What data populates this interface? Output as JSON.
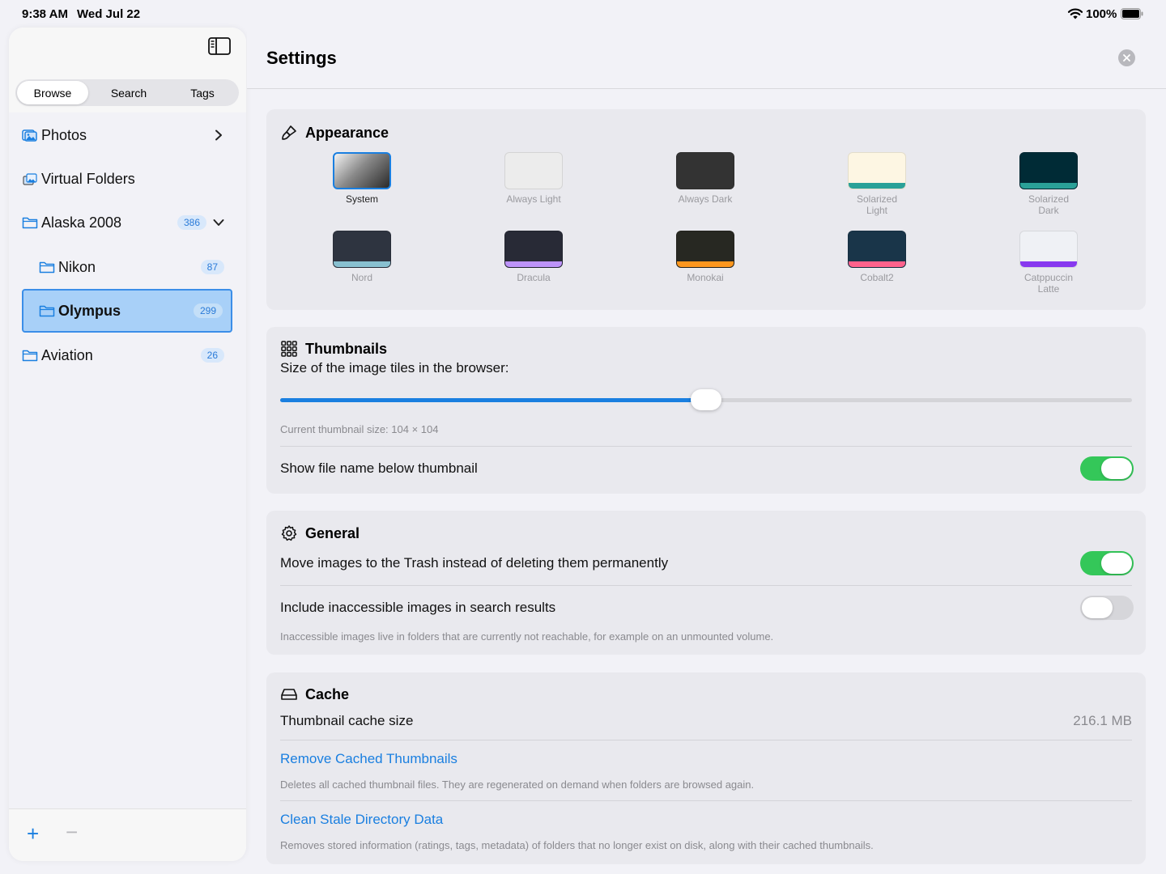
{
  "status_bar": {
    "time": "9:38 AM",
    "date": "Wed Jul 22",
    "battery": "100%"
  },
  "sidebar": {
    "tabs": [
      "Browse",
      "Search",
      "Tags"
    ],
    "active_tab": "Browse",
    "items": [
      {
        "label": "Photos",
        "icon": "photos-icon",
        "badge": "",
        "chevron": "right"
      },
      {
        "label": "Virtual Folders",
        "icon": "virtual-folders-icon",
        "badge": ""
      },
      {
        "label": "Alaska 2008",
        "icon": "folder-icon",
        "badge": "386",
        "chevron": "down"
      },
      {
        "label": "Nikon",
        "icon": "folder-icon",
        "badge": "87"
      },
      {
        "label": "Olympus",
        "icon": "folder-icon",
        "badge": "299",
        "selected": true
      },
      {
        "label": "Aviation",
        "icon": "folder-icon",
        "badge": "26"
      }
    ],
    "footer": {
      "add": "+",
      "remove": "−"
    }
  },
  "main": {
    "title": "Settings",
    "appearance": {
      "heading": "Appearance",
      "themes": [
        {
          "name": "System",
          "top": "#888888",
          "bar": "",
          "selected": true
        },
        {
          "name": "Always Light",
          "top": "#ececec",
          "bar": ""
        },
        {
          "name": "Always Dark",
          "top": "#333333",
          "bar": ""
        },
        {
          "name": "Solarized\nLight",
          "top": "#fdf6e3",
          "bar": "#2aa198"
        },
        {
          "name": "Solarized\nDark",
          "top": "#002b36",
          "bar": "#2aa198"
        },
        {
          "name": "Nord",
          "top": "#2e3440",
          "bar": "#88c0d0"
        },
        {
          "name": "Dracula",
          "top": "#282a36",
          "bar": "#bd93f9"
        },
        {
          "name": "Monokai",
          "top": "#272822",
          "bar": "#fd971f"
        },
        {
          "name": "Cobalt2",
          "top": "#193549",
          "bar": "#ff628c"
        },
        {
          "name": "Catppuccin\nLatte",
          "top": "#eff1f5",
          "bar": "#8839ef"
        }
      ]
    },
    "thumbnails": {
      "heading": "Thumbnails",
      "slider_label": "Size of the image tiles in the browser:",
      "slider_value": 0.5,
      "current_size": "Current thumbnail size: 104 × 104",
      "show_filename_label": "Show file name below thumbnail",
      "show_filename": true
    },
    "general": {
      "heading": "General",
      "trash_label": "Move images to the Trash instead of deleting them permanently",
      "trash": true,
      "inaccessible_label": "Include inaccessible images in search results",
      "inaccessible": false,
      "inaccessible_note": "Inaccessible images live in folders that are currently not reachable, for example on an unmounted volume."
    },
    "cache": {
      "heading": "Cache",
      "size_label": "Thumbnail cache size",
      "size_value": "216.1 MB",
      "remove_link": "Remove Cached Thumbnails",
      "remove_note": "Deletes all cached thumbnail files. They are regenerated on demand when folders are browsed again.",
      "clean_link": "Clean Stale Directory Data",
      "clean_note": "Removes stored information (ratings, tags, metadata) of folders that no longer exist on disk, along with their cached thumbnails."
    }
  },
  "colors": {
    "accent": "#1a7fe0",
    "toggle_on": "#34c759",
    "selection": "#a8d0f8"
  }
}
